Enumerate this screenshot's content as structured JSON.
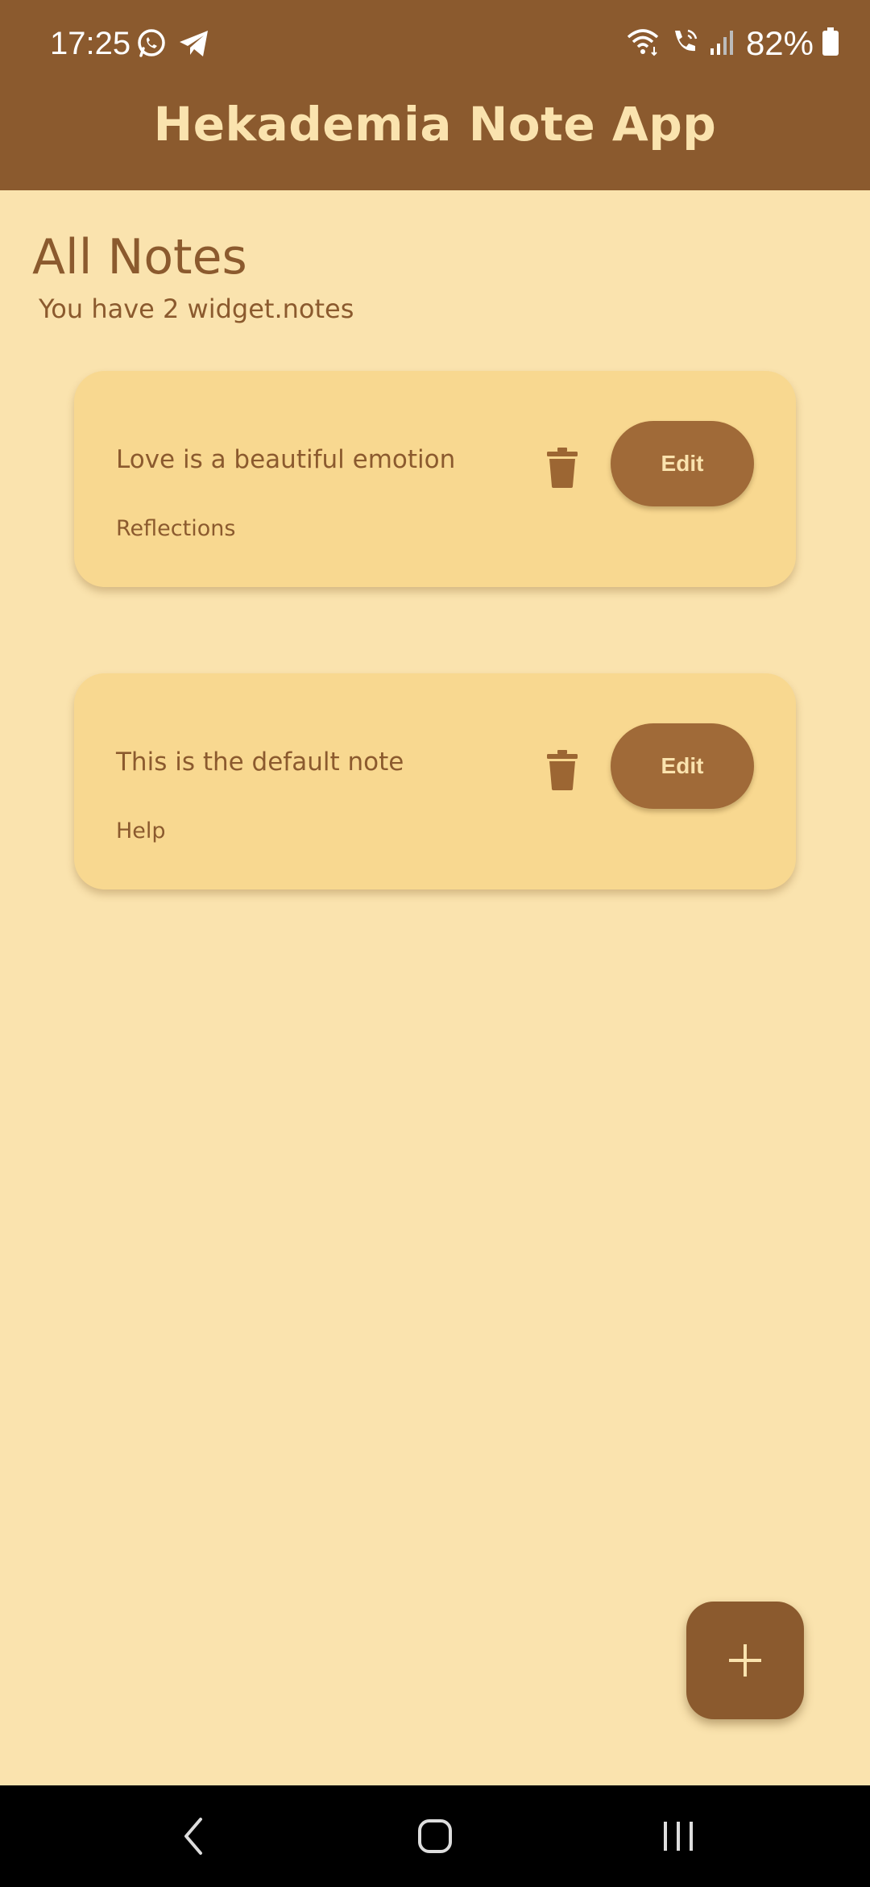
{
  "status_bar": {
    "time": "17:25",
    "left_icons": [
      "whatsapp-icon",
      "telegram-icon"
    ],
    "right_icons": [
      "wifi-icon",
      "wifi-calling-icon",
      "signal-icon",
      "battery-icon"
    ],
    "battery_percent": "82%"
  },
  "app_bar": {
    "title": "Hekademia Note App"
  },
  "page": {
    "title": "All Notes",
    "subtitle": "You have 2 widget.notes"
  },
  "notes": [
    {
      "title": "Love is a beautiful emotion",
      "category": "Reflections",
      "edit_label": "Edit",
      "delete_icon": "trash-icon"
    },
    {
      "title": "This is the default note",
      "category": "Help",
      "edit_label": "Edit",
      "delete_icon": "trash-icon"
    }
  ],
  "fab": {
    "icon": "plus-icon"
  },
  "nav_bar": {
    "buttons": [
      "back-icon",
      "home-icon",
      "recents-icon"
    ]
  },
  "colors": {
    "primary": "#8B5A2E",
    "background": "#FAE3AE",
    "card": "#F8D890",
    "button": "#A06A38",
    "button_text": "#FAE3AE"
  }
}
